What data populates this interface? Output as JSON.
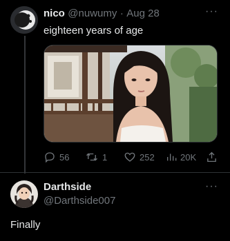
{
  "tweet": {
    "author_name": "nico",
    "author_handle": "@nuwumy",
    "separator": "·",
    "date": "Aug 28",
    "text": "eighteen years of age",
    "more_label": "···",
    "stats": {
      "replies": "56",
      "retweets": "1",
      "likes": "252",
      "views": "20K"
    }
  },
  "reply": {
    "author_name": "Darthside",
    "author_handle": "@Darthside007",
    "text": "Finally",
    "more_label": "···"
  },
  "icons": [
    "reply-icon",
    "retweet-icon",
    "like-icon",
    "views-icon",
    "share-icon",
    "more-icon"
  ],
  "colors": {
    "background": "#000000",
    "text": "#e7e9ea",
    "muted": "#71767b"
  }
}
